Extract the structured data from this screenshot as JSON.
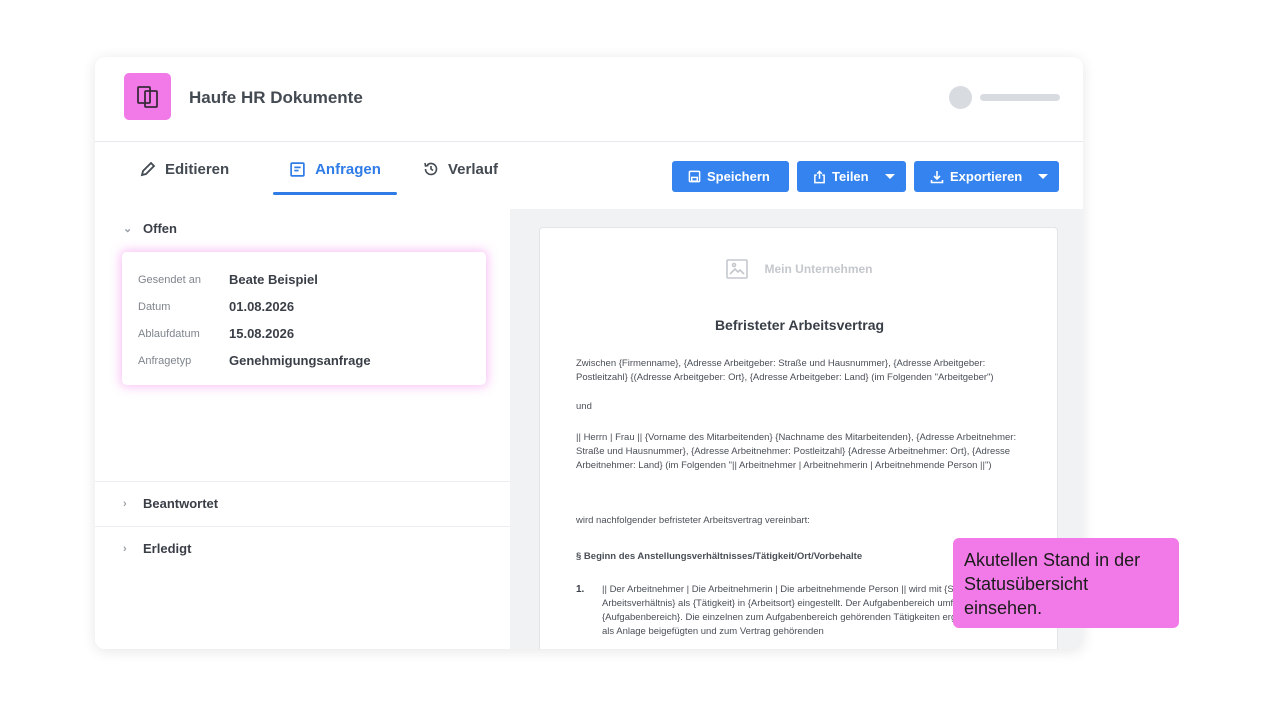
{
  "app": {
    "title": "Haufe HR Dokumente"
  },
  "tabs": {
    "edit": "Editieren",
    "requests": "Anfragen",
    "history": "Verlauf"
  },
  "actions": {
    "save": "Speichern",
    "share": "Teilen",
    "export": "Exportieren"
  },
  "sections": {
    "open": "Offen",
    "answered": "Beantwortet",
    "done": "Erledigt"
  },
  "request_card": {
    "rows": [
      {
        "label": "Gesendet an",
        "value": "Beate Beispiel"
      },
      {
        "label": "Datum",
        "value": "01.08.2026"
      },
      {
        "label": "Ablaufdatum",
        "value": "15.08.2026"
      },
      {
        "label": "Anfragetyp",
        "value": "Genehmigungsanfrage"
      }
    ]
  },
  "document": {
    "company": "Mein Unternehmen",
    "title": "Befristeter Arbeitsvertrag",
    "p1": "Zwischen {Firmenname}, {Adresse Arbeitgeber: Straße und Hausnummer}, {Adresse Arbeitgeber: Postleitzahl} {(Adresse Arbeitgeber: Ort}, {Adresse Arbeitgeber: Land} (im Folgenden \"Arbeitgeber\")",
    "p2": "und",
    "p3": "|| Herrn | Frau || {Vorname des Mitarbeitenden} {Nachname des Mitarbeitenden}, {Adresse Arbeitnehmer: Straße und Hausnummer}, {Adresse Arbeitnehmer: Postleitzahl} {Adresse Arbeitnehmer: Ort}, {Adresse Arbeitnehmer: Land} (im Folgenden \"|| Arbeitnehmer | Arbeitnehmerin | Arbeitnehmende Person ||\")",
    "p4": "wird nachfolgender befristeter Arbeitsvertrag vereinbart:",
    "heading": "§ Beginn des Anstellungsverhältnisses/Tätigkeit/Ort/Vorbehalte",
    "item_number": "1.",
    "item_text": "|| Der Arbeitnehmer | Die Arbeitnehmerin | Die arbeitnehmende Person || wird mit {Startdatum Arbeitsverhältnis} als {Tätigkeit} in {Arbeitsort} eingestellt. Der Aufgabenbereich umfasst insbesondere {Aufgabenbereich}. Die einzelnen zum Aufgabenbereich gehörenden Tätigkeiten ergeben sich aus der als Anlage beigefügten und zum Vertrag gehörenden"
  },
  "callout": {
    "text": "Akutellen Stand in der Statusübersicht einsehen."
  },
  "colors": {
    "accent": "#3583ee",
    "brand": "#f27ae8"
  }
}
